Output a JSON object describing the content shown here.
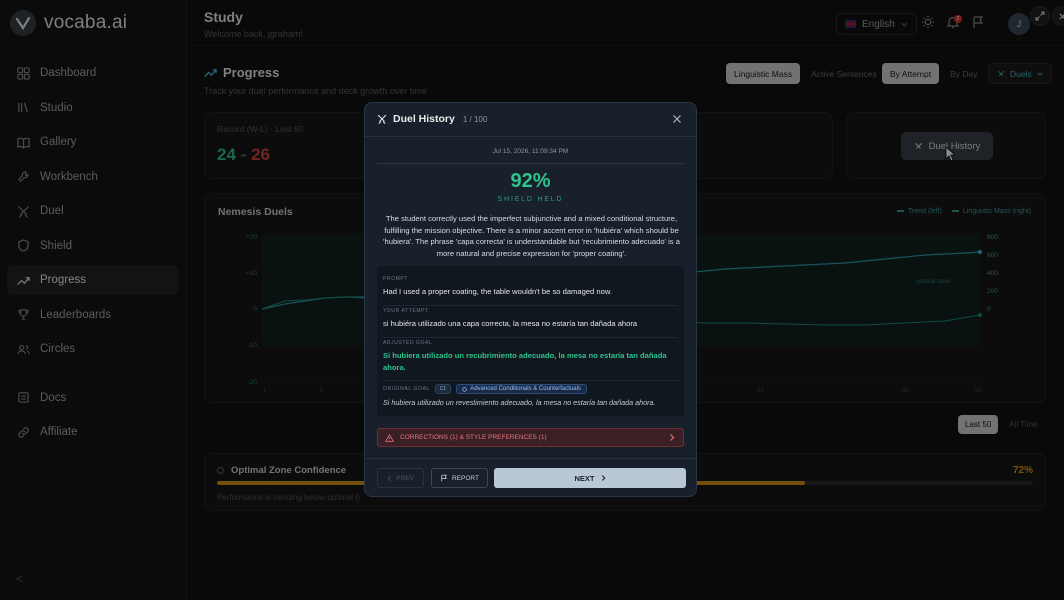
{
  "brand": {
    "name": "vocaba.ai"
  },
  "sidebar": {
    "items": [
      {
        "label": "Dashboard",
        "icon": "grid-icon"
      },
      {
        "label": "Studio",
        "icon": "library-icon"
      },
      {
        "label": "Gallery",
        "icon": "book-icon"
      },
      {
        "label": "Workbench",
        "icon": "wrench-icon"
      },
      {
        "label": "Duel",
        "icon": "swords-icon"
      },
      {
        "label": "Shield",
        "icon": "shield-icon"
      },
      {
        "label": "Progress",
        "icon": "trend-icon",
        "active": true
      },
      {
        "label": "Leaderboards",
        "icon": "trophy-icon"
      },
      {
        "label": "Circles",
        "icon": "users-icon"
      },
      {
        "label": "Docs",
        "icon": "docs-icon"
      },
      {
        "label": "Affiliate",
        "icon": "link-icon"
      }
    ],
    "collapse": "<"
  },
  "header": {
    "title": "Study",
    "subtitle": "Welcome back, jgraham!",
    "language": "English",
    "notifications": "2",
    "avatar": "J"
  },
  "page": {
    "title": "Progress",
    "subtitle": "Track your duel performance and deck growth over time",
    "metric_toggle": [
      "Linguistic Mass",
      "Active Sentences"
    ],
    "metric_active": "Linguistic Mass",
    "mode_toggle": [
      "By Attempt",
      "By Day"
    ],
    "mode_active": "By Attempt",
    "filter": "Duels"
  },
  "record": {
    "label": "Record (W-L) · Last 50",
    "wins": "24",
    "dash": "-",
    "losses": "26"
  },
  "duel_history_button": "Duel History",
  "nemesis": {
    "title": "Nemesis Duels",
    "legend": [
      "Trend (left)",
      "Linguistic Mass (right)"
    ],
    "zone_label": "optimal zone",
    "left_ticks": [
      "+20",
      "+10",
      "0",
      "-10",
      "-20"
    ],
    "right_ticks": [
      "800",
      "600",
      "400",
      "200",
      "0"
    ],
    "x_ticks": [
      "1",
      "5",
      "25",
      "45",
      "50"
    ]
  },
  "range": {
    "options": [
      "Last 50",
      "All Time"
    ],
    "active": "Last 50"
  },
  "optimal_zone": {
    "title": "Optimal Zone Confidence",
    "percent": "72%",
    "progress": 0.72,
    "note": "Performance is trending below optimal (l"
  },
  "modal": {
    "title": "Duel History",
    "counter": "1 / 100",
    "timestamp": "Jul 15, 2026, 11:09:34 PM",
    "score": "92%",
    "status": "SHIELD HELD",
    "feedback": "The student correctly used the imperfect subjunctive and a mixed conditional structure, fulfilling the mission objective. There is a minor accent error in 'hubiéra' which should be 'hubiera'. The phrase 'capa correcta' is understandable but 'recubrimiento adecuado' is a more natural and precise expression for 'proper coating'.",
    "prompt_label": "PROMPT",
    "prompt": "Had I used a proper coating, the table wouldn't be so damaged now.",
    "attempt_label": "YOUR ATTEMPT",
    "attempt": "si hubiéra utilizado una capa correcta, la mesa no estaría tan dañada ahora",
    "adjusted_label": "ADJUSTED GOAL",
    "adjusted": "Si hubiera utilizado un recubrimiento adecuado, la mesa no estaría tan dañada ahora.",
    "original_label": "ORIGINAL GOAL",
    "level": "C1",
    "topic": "Advanced Conditionals & Counterfactuals",
    "original": "Si hubiera utilizado un revestimiento adecuado, la mesa no estaría tan dañada ahora.",
    "corrections": "CORRECTIONS (1) & STYLE PREFERENCES (1)",
    "prev": "PREV",
    "report": "REPORT",
    "next": "NEXT"
  },
  "colors": {
    "accent": "#2ec48d",
    "loss": "#d0433b",
    "teal": "#3fb8c9",
    "warn": "#e09a1c"
  }
}
